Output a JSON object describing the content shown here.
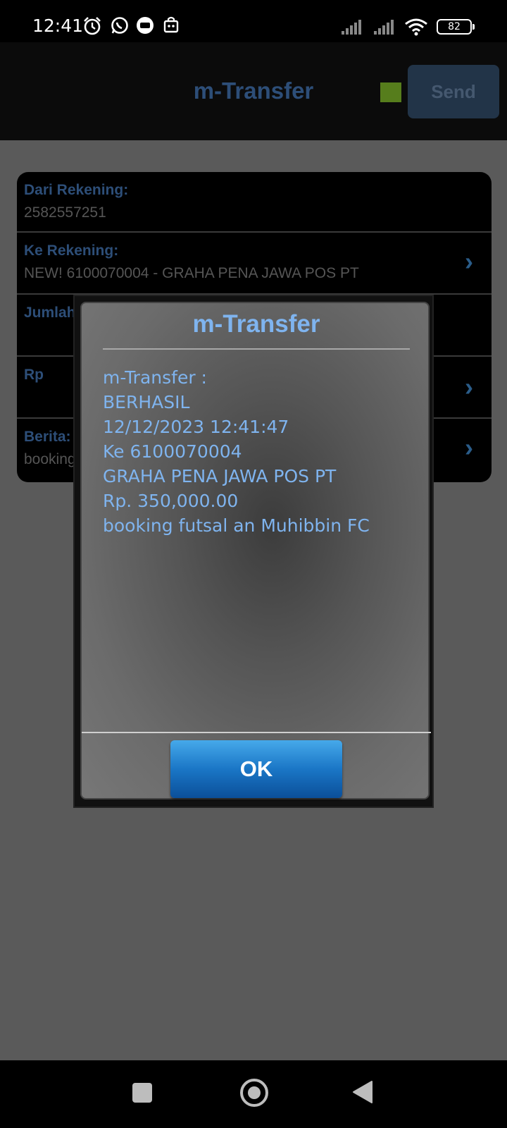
{
  "status_bar": {
    "time": "12:41",
    "battery": "82",
    "icons": [
      "alarm-icon",
      "whatsapp-icon",
      "message-icon",
      "shopping-bag-icon",
      "signal-icon",
      "signal-icon",
      "wifi-icon",
      "battery-icon"
    ]
  },
  "header": {
    "title": "m-Transfer",
    "send_label": "Send",
    "indicator_color": "#567d1c"
  },
  "form": {
    "rows": [
      {
        "label": "Dari Rekening:",
        "value": "2582557251"
      },
      {
        "label": "Ke Rekening:",
        "value": "NEW! 6100070004 - GRAHA PENA JAWA POS PT"
      },
      {
        "label": "Jumlah",
        "value": ""
      },
      {
        "label": "Rp",
        "value": ""
      },
      {
        "label": "Berita:",
        "value": "booking futsal an Muhibbin FC"
      }
    ]
  },
  "dialog": {
    "title": "m-Transfer",
    "lines": [
      "m-Transfer :",
      "BERHASIL",
      "12/12/2023 12:41:47",
      "Ke 6100070004",
      "GRAHA PENA JAWA POS PT",
      "Rp. 350,000.00",
      "booking futsal an Muhibbin FC"
    ],
    "ok_label": "OK"
  },
  "colors": {
    "label_color": "#2d4e78",
    "dialog_text": "#7fb4ef",
    "ok_button": "#1a76c6"
  }
}
